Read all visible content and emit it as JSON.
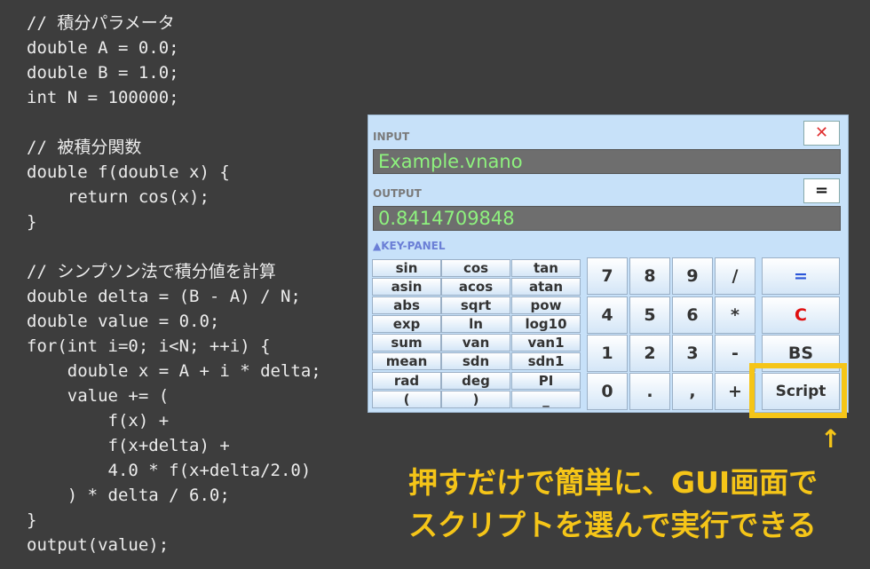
{
  "code_lines": [
    "// 積分パラメータ",
    "double A = 0.0;",
    "double B = 1.0;",
    "int N = 100000;",
    "",
    "// 被積分関数",
    "double f(double x) {",
    "    return cos(x);",
    "}",
    "",
    "// シンプソン法で積分値を計算",
    "double delta = (B - A) / N;",
    "double value = 0.0;",
    "for(int i=0; i<N; ++i) {",
    "    double x = A + i * delta;",
    "    value += (",
    "        f(x) +",
    "        f(x+delta) +",
    "        4.0 * f(x+delta/2.0)",
    "    ) * delta / 6.0;",
    "}",
    "output(value);"
  ],
  "calculator": {
    "input_label": "INPUT",
    "input_value": "Example.vnano",
    "close_label": "✕",
    "output_label": "OUTPUT",
    "output_value": "0.8414709848",
    "equals_small_label": "=",
    "key_panel_label": "▲KEY-PANEL",
    "function_keys": [
      [
        "sin",
        "cos",
        "tan"
      ],
      [
        "asin",
        "acos",
        "atan"
      ],
      [
        "abs",
        "sqrt",
        "pow"
      ],
      [
        "exp",
        "ln",
        "log10"
      ],
      [
        "sum",
        "van",
        "van1"
      ],
      [
        "mean",
        "sdn",
        "sdn1"
      ],
      [
        "rad",
        "deg",
        "PI"
      ],
      [
        "(",
        ")",
        "_"
      ]
    ],
    "number_keys": [
      [
        "7",
        "8",
        "9",
        "/"
      ],
      [
        "4",
        "5",
        "6",
        "*"
      ],
      [
        "1",
        "2",
        "3",
        "-"
      ],
      [
        "0",
        ".",
        ",",
        "+"
      ]
    ],
    "right_keys": {
      "equals": "=",
      "clear": "C",
      "backspace": "BS",
      "script": "Script"
    }
  },
  "annotation": {
    "arrow": "↑",
    "line1": "押すだけで簡単に、GUI画面で",
    "line2": "スクリプトを選んで実行できる"
  },
  "colors": {
    "background": "#3d3d3d",
    "panel": "#c7e1f9",
    "field_bg": "#6e6e6e",
    "field_text": "#8ef27e",
    "highlight": "#f5c518",
    "equals_blue": "#2b56d8",
    "clear_red": "#e01010"
  }
}
